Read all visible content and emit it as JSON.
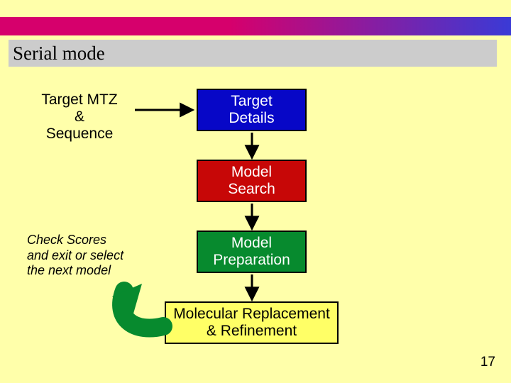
{
  "title": "Serial mode",
  "input_label": "Target MTZ\n&\nSequence",
  "check_label": "Check Scores\nand exit or select\nthe next model",
  "nodes": {
    "target_details": "Target\nDetails",
    "model_search": "Model\nSearch",
    "model_preparation": "Model\nPreparation",
    "mr_refinement": "Molecular Replacement\n& Refinement"
  },
  "page_number": "17"
}
